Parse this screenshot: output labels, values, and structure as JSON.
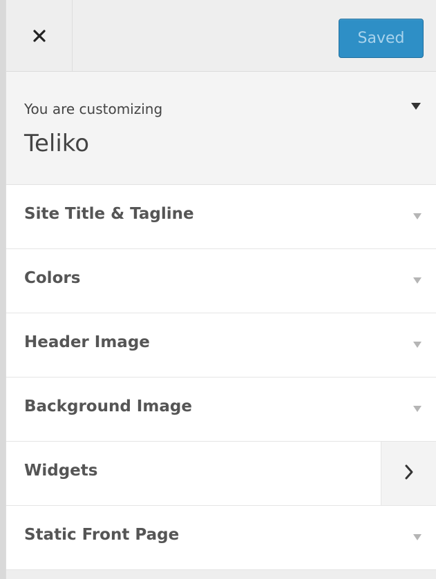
{
  "header": {
    "close_icon": "close-icon",
    "saved_label": "Saved",
    "saved_color": "#2e8fc6"
  },
  "info": {
    "pre_label": "You are customizing",
    "theme_name": "Teliko",
    "toggle_icon": "triangle-down-icon"
  },
  "sections": [
    {
      "label": "Site Title & Tagline",
      "icon": "triangle-down-icon"
    },
    {
      "label": "Colors",
      "icon": "triangle-down-icon"
    },
    {
      "label": "Header Image",
      "icon": "triangle-down-icon"
    },
    {
      "label": "Background Image",
      "icon": "triangle-down-icon"
    },
    {
      "label": "Widgets",
      "icon": "chevron-right-icon"
    },
    {
      "label": "Static Front Page",
      "icon": "triangle-down-icon"
    }
  ]
}
